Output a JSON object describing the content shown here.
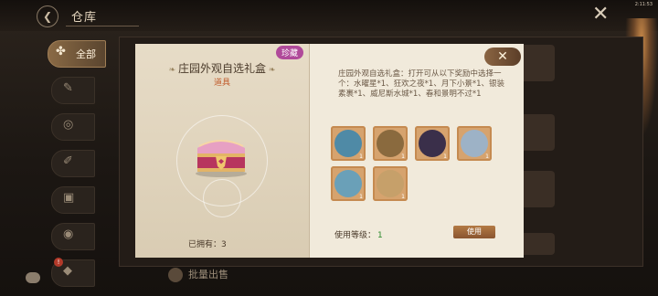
{
  "header": {
    "title": "仓库",
    "time": "2:11:53"
  },
  "sidebar": {
    "items": [
      {
        "label": "全部",
        "icon": "clover-icon",
        "active": true
      },
      {
        "icon": "quill-icon"
      },
      {
        "icon": "ring-icon"
      },
      {
        "icon": "pen-icon"
      },
      {
        "icon": "chest-icon"
      },
      {
        "icon": "spiral-icon"
      },
      {
        "icon": "gem-icon",
        "badge": "!"
      }
    ]
  },
  "footer": {
    "bulk_sell": "批量出售"
  },
  "modal": {
    "rarity": "珍藏",
    "item_name": "庄园外观自选礼盒",
    "item_type": "道具",
    "owned": "已拥有：3",
    "description": "庄园外观自选礼盒：打开可从以下奖励中选择一个：水曜星*1、狂欢之夜*1、月下小景*1、银装素裹*1、威尼斯水城*1、春和景明不过*1",
    "level_label": "使用等级：",
    "level_value": "1",
    "use_label": "使用",
    "rewards": [
      {
        "count": "1",
        "color": "#4f8aa6"
      },
      {
        "count": "1",
        "color": "#8a6a3e"
      },
      {
        "count": "1",
        "color": "#3a2f4a"
      },
      {
        "count": "1",
        "color": "#9db2c6"
      },
      {
        "count": "1",
        "color": "#6aa0b8"
      },
      {
        "count": "1",
        "color": "#c6a06a"
      }
    ]
  },
  "colors": {
    "accent": "#b04a9a",
    "level": "#2b8a2b",
    "button": "#8a5530"
  }
}
